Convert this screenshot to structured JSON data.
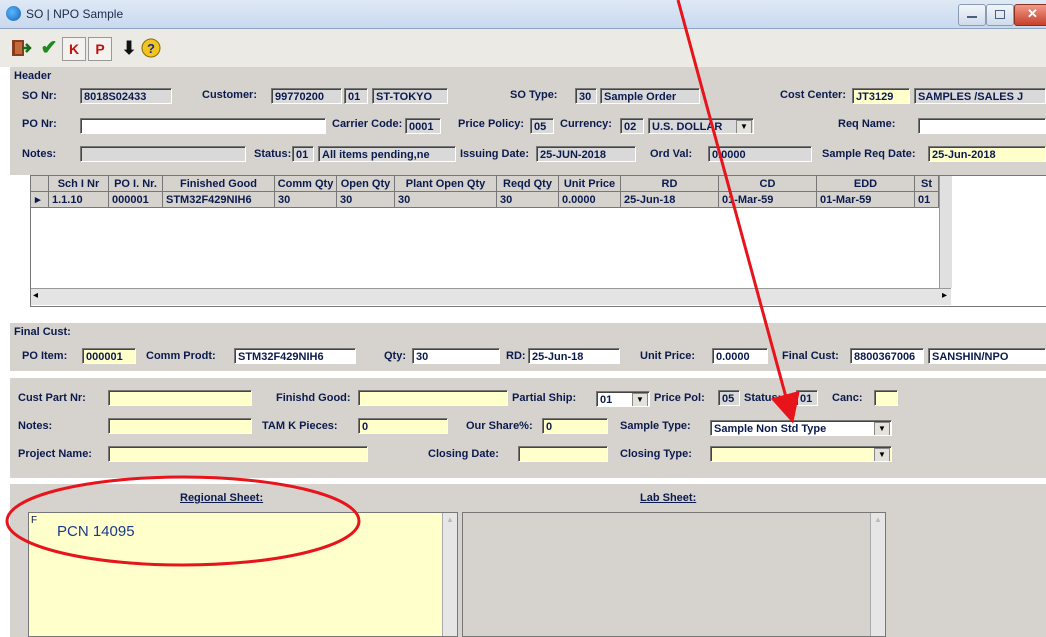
{
  "window": {
    "title": "SO | NPO Sample"
  },
  "toolbar": {
    "k_label": "K",
    "p_label": "P"
  },
  "header": {
    "section_label": "Header",
    "so_nr_label": "SO Nr:",
    "so_nr": "8018S02433",
    "customer_label": "Customer:",
    "customer_code": "99770200",
    "customer_sub": "01",
    "customer_name": "ST-TOKYO",
    "so_type_label": "SO Type:",
    "so_type_code": "30",
    "so_type_name": "Sample Order",
    "cost_center_label": "Cost Center:",
    "cost_center_code": "JT3129",
    "cost_center_name": "SAMPLES /SALES J",
    "po_nr_label": "PO Nr:",
    "po_nr": "",
    "carrier_code_label": "Carrier Code:",
    "carrier_code": "0001",
    "price_policy_label": "Price Policy:",
    "price_policy": "05",
    "currency_label": "Currency:",
    "currency_code": "02",
    "currency_name": "U.S. DOLLAR",
    "req_name_label": "Req Name:",
    "req_name": "",
    "notes_label": "Notes:",
    "notes": "",
    "status_label": "Status:",
    "status_code": "01",
    "status_text": "All items pending,ne",
    "issuing_date_label": "Issuing Date:",
    "issuing_date": "25-JUN-2018",
    "ord_val_label": "Ord Val:",
    "ord_val": "0.0000",
    "sample_req_date_label": "Sample Req Date:",
    "sample_req_date": "25-Jun-2018"
  },
  "grid": {
    "columns": [
      "Sch I Nr",
      "PO I. Nr.",
      "Finished Good",
      "Comm Qty",
      "Open Qty",
      "Plant Open Qty",
      "Reqd Qty",
      "Unit Price",
      "RD",
      "CD",
      "EDD",
      "St"
    ],
    "rows": [
      [
        "1.1.10",
        "000001",
        "STM32F429NIH6",
        "30",
        "30",
        "30",
        "30",
        "0.0000",
        "25-Jun-18",
        "01-Mar-59",
        "01-Mar-59",
        "01"
      ]
    ],
    "row_indicator": "▸"
  },
  "final_cust": {
    "section_label": "Final Cust:",
    "po_item_label": "PO Item:",
    "po_item": "000001",
    "comm_prodt_label": "Comm Prodt:",
    "comm_prodt": "STM32F429NIH6",
    "qty_label": "Qty:",
    "qty": "30",
    "rd_label": "RD:",
    "rd": "25-Jun-18",
    "unit_price_label": "Unit Price:",
    "unit_price": "0.0000",
    "final_cust_label": "Final Cust:",
    "final_cust_code": "8800367006",
    "final_cust_name": "SANSHIN/NPO"
  },
  "item": {
    "cust_part_label": "Cust Part Nr:",
    "cust_part": "",
    "finished_good_label": "Finishd Good:",
    "finished_good": "",
    "partial_ship_label": "Partial Ship:",
    "partial_ship": "01",
    "price_pol_label": "Price Pol:",
    "price_pol": "05",
    "status_label": "Status:",
    "status": "01",
    "canc_label": "Canc:",
    "canc": "",
    "notes_label": "Notes:",
    "notes": "",
    "tam_k_label": "TAM K Pieces:",
    "tam_k": "0",
    "our_share_label": "Our Share%:",
    "our_share": "0",
    "sample_type_label": "Sample Type:",
    "sample_type": "Sample Non Std Type",
    "project_name_label": "Project Name:",
    "project_name": "",
    "closing_date_label": "Closing Date:",
    "closing_date": "",
    "closing_type_label": "Closing Type:",
    "closing_type": ""
  },
  "sheets": {
    "regional_label": "Regional Sheet:",
    "lab_label": "Lab Sheet:",
    "regional_text": "PCN 14095",
    "regional_caret": "F"
  },
  "colors": {
    "annotation": "#e8141b",
    "panel": "#d6d3ce",
    "input_yellow": "#ffffcc"
  }
}
